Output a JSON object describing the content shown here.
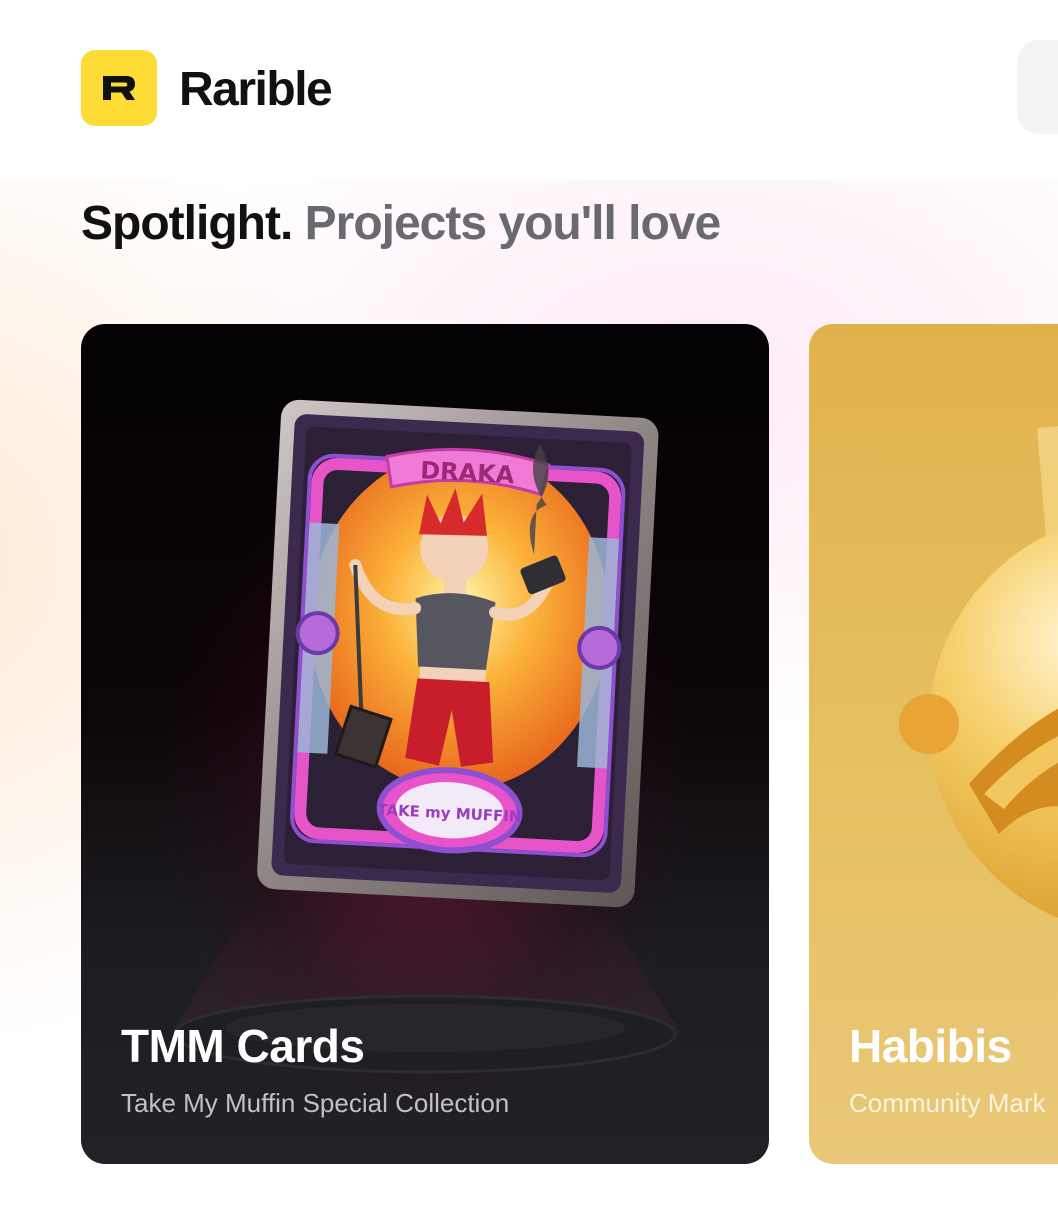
{
  "header": {
    "brand_name": "Rarible",
    "logo_icon": "rarible-r-logo-icon",
    "brand_color": "#fedb35"
  },
  "section": {
    "title_lead": "Spotlight.",
    "title_sub": "Projects you'll love"
  },
  "cards": [
    {
      "title": "TMM Cards",
      "subtitle": "Take My Muffin Special Collection",
      "art_label": "DRAKA",
      "art_caption": "TAKE my MUFFIN",
      "background": "#0c0509"
    },
    {
      "title": "Habibis",
      "subtitle": "Community Mark",
      "background": "#e1b24b"
    }
  ]
}
